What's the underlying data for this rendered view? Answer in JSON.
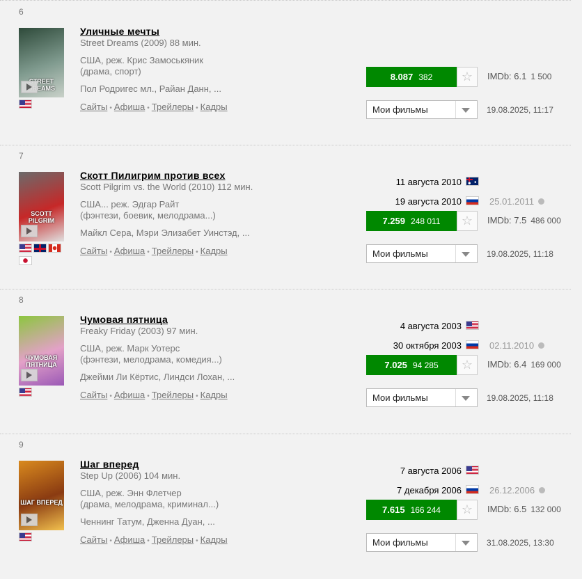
{
  "movies": [
    {
      "num": "6",
      "title": "Уличные мечты",
      "orig": "Street Dreams (2009) 88 мин.",
      "director": "США, реж. Крис Замоськяник",
      "genres": "(драма, спорт)",
      "actors": "Пол Родригес мл., Райан Данн, ...",
      "poster_text": "STREET DREAMS",
      "flags": [
        "us"
      ],
      "releases": [],
      "release_note": "",
      "rating": "8.087",
      "rating_count": "382",
      "imdb": "IMDb: 6.1",
      "imdb_votes": "1 500",
      "my_films": "Мои фильмы",
      "date": "19.08.2025, 11:17"
    },
    {
      "num": "7",
      "title": "Скотт Пилигрим против всех",
      "orig": "Scott Pilgrim vs. the World (2010) 112 мин.",
      "director": "США... реж. Эдгар Райт",
      "genres": "(фэнтези, боевик, мелодрама...)",
      "actors": "Майкл Сера, Мэри Элизабет Уинстэд, ...",
      "poster_text": "SCOTT PILGRIM",
      "flags": [
        "us",
        "gb",
        "ca",
        "jp"
      ],
      "releases": [
        {
          "text": "11 августа 2010",
          "flag": "au"
        },
        {
          "text": "19 августа 2010",
          "flag": "ru"
        }
      ],
      "release_note": "25.01.2011",
      "rating": "7.259",
      "rating_count": "248 011",
      "imdb": "IMDb: 7.5",
      "imdb_votes": "486 000",
      "my_films": "Мои фильмы",
      "date": "19.08.2025, 11:18"
    },
    {
      "num": "8",
      "title": "Чумовая пятница",
      "orig": "Freaky Friday (2003) 97 мин.",
      "director": "США, реж. Марк Уотерс",
      "genres": "(фэнтези, мелодрама, комедия...)",
      "actors": "Джейми Ли Кёртис, Линдси Лохан, ...",
      "poster_text": "ЧУМОВАЯ ПЯТНИЦА",
      "flags": [
        "us"
      ],
      "releases": [
        {
          "text": "4 августа 2003",
          "flag": "us"
        },
        {
          "text": "30 октября 2003",
          "flag": "ru"
        }
      ],
      "release_note": "02.11.2010",
      "rating": "7.025",
      "rating_count": "94 285",
      "imdb": "IMDb: 6.4",
      "imdb_votes": "169 000",
      "my_films": "Мои фильмы",
      "date": "19.08.2025, 11:18"
    },
    {
      "num": "9",
      "title": "Шаг вперед",
      "orig": "Step Up (2006) 104 мин.",
      "director": "США, реж. Энн Флетчер",
      "genres": "(драма, мелодрама, криминал...)",
      "actors": "Ченнинг Татум, Дженна Дуан, ...",
      "poster_text": "ШАГ ВПЕРЕД",
      "flags": [
        "us"
      ],
      "releases": [
        {
          "text": "7 августа 2006",
          "flag": "us"
        },
        {
          "text": "7 декабря 2006",
          "flag": "ru"
        }
      ],
      "release_note": "26.12.2006",
      "rating": "7.615",
      "rating_count": "166 244",
      "imdb": "IMDb: 6.5",
      "imdb_votes": "132 000",
      "my_films": "Мои фильмы",
      "date": "31.08.2025, 13:30"
    }
  ],
  "links": [
    "Сайты",
    "Афиша",
    "Трейлеры",
    "Кадры"
  ],
  "colors": {
    "rating_bg": "#008800",
    "title": "#000000",
    "background": "#f2f2f2"
  },
  "poster_palettes": [
    [
      "#2e4a3a",
      "#7f9a8e",
      "#c9d1c9"
    ],
    [
      "#6b6b6b",
      "#c62828",
      "#e0e0e0"
    ],
    [
      "#8cc63f",
      "#e3a1c8",
      "#9b59b6"
    ],
    [
      "#d98a1e",
      "#8a3b12",
      "#f2c14e"
    ]
  ]
}
